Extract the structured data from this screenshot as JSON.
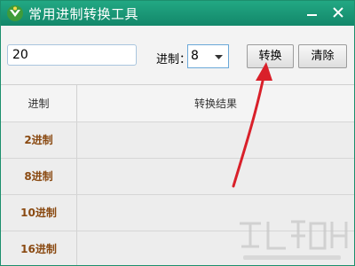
{
  "window": {
    "title": "常用进制转换工具",
    "icon": "app-icon",
    "minimize_icon": "minimize-icon",
    "close_icon": "close-icon"
  },
  "toolbar": {
    "number_input_value": "20",
    "base_label": "进制：",
    "base_select_value": "8",
    "convert_label": "转换",
    "clear_label": "清除"
  },
  "table": {
    "headers": [
      "进制",
      "转换结果"
    ],
    "rows": [
      {
        "base": "2进制",
        "result": ""
      },
      {
        "base": "8进制",
        "result": ""
      },
      {
        "base": "10进制",
        "result": ""
      },
      {
        "base": "16进制",
        "result": ""
      }
    ]
  },
  "annotation": {
    "arrow_color": "#d9202a",
    "icon": "red-arrow-icon"
  },
  "colors": {
    "titlebar": "#13876a",
    "base_text": "#8a4a12",
    "select_border": "#6aa8d8"
  }
}
